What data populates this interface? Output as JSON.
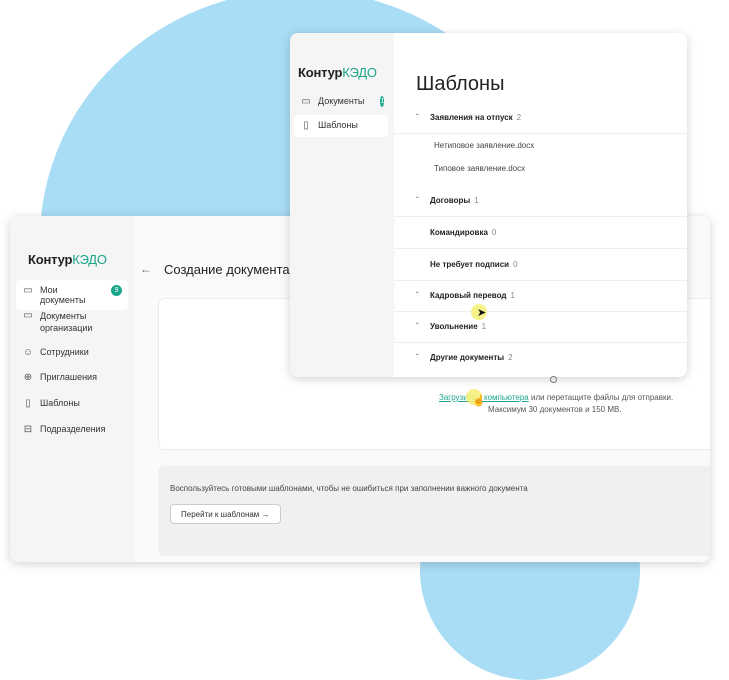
{
  "back_window": {
    "logo_primary": "Контур",
    "logo_accent": "КЭДО",
    "nav": [
      {
        "label": "Мои документы",
        "icon": "document-icon",
        "badge": "9",
        "active": true
      },
      {
        "label": "Документы организации",
        "icon": "document-icon"
      },
      {
        "label": "Сотрудники",
        "icon": "users-icon"
      },
      {
        "label": "Приглашения",
        "icon": "plus-circle-icon"
      },
      {
        "label": "Шаблоны",
        "icon": "book-icon"
      },
      {
        "label": "Подразделения",
        "icon": "structure-icon"
      }
    ],
    "page_title": "Создание документа",
    "upload_link": "Загрузить с компьютера",
    "upload_text_rest": " или перетащите файлы для отправки.",
    "upload_limits": "Максимум 30 документов и 150 MB.",
    "template_hint": "Воспользуйтесь готовыми шаблонами, чтобы не ошибиться при заполнении важного документа",
    "goto_templates": "Перейти к шаблонам →"
  },
  "front_window": {
    "logo_primary": "Контур",
    "logo_accent": "КЭДО",
    "nav": [
      {
        "label": "Документы",
        "icon": "document-icon",
        "badge": "1"
      },
      {
        "label": "Шаблоны",
        "icon": "book-icon",
        "active": true
      }
    ],
    "title": "Шаблоны",
    "groups": [
      {
        "name": "Заявления на отпуск",
        "count": "2",
        "expanded": true,
        "files": [
          "Нетиповое заявление.docx",
          "Типовое заявление.docx"
        ]
      },
      {
        "name": "Договоры",
        "count": "1",
        "expanded": false
      },
      {
        "name": "Командировка",
        "count": "0",
        "expanded": false
      },
      {
        "name": "Не требует подписи",
        "count": "0",
        "expanded": false
      },
      {
        "name": "Кадровый перевод",
        "count": "1",
        "expanded": false
      },
      {
        "name": "Увольнение",
        "count": "1",
        "expanded": false
      },
      {
        "name": "Другие документы",
        "count": "2",
        "expanded": false
      }
    ]
  },
  "colors": {
    "accent": "#1aa68a",
    "blob": "#a9dcf5",
    "cursor_highlight": "#f6ef7c"
  }
}
